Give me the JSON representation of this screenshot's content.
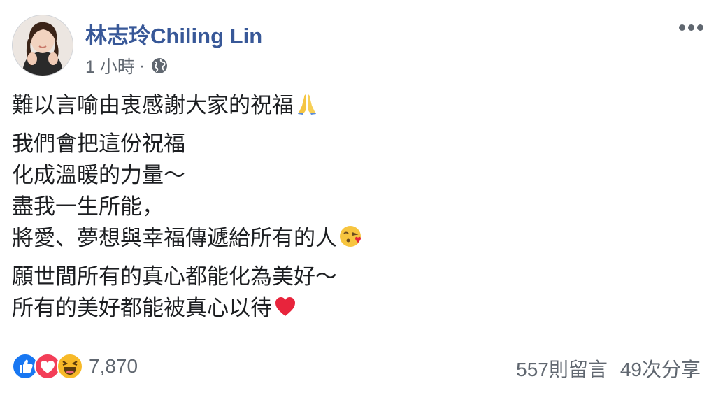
{
  "post": {
    "author": "林志玲Chiling Lin",
    "time": "1 小時",
    "separator": "·",
    "privacy_icon": "globe-icon",
    "more_icon": "ellipsis-icon",
    "paragraphs": [
      [
        "難以言喻由衷感謝大家的祝福"
      ],
      [
        "我們會把這份祝福",
        "化成溫暖的力量～",
        "盡我一生所能，",
        "將愛、夢想與幸福傳遞給所有的人"
      ],
      [
        "願世間所有的真心都能化為美好～",
        "所有的美好都能被真心以待"
      ]
    ],
    "emojis": {
      "p0_l0": "folded-hands-emoji",
      "p1_l3": "face-blowing-kiss-emoji",
      "p2_l1": "red-heart-emoji"
    }
  },
  "reactions": {
    "icons": [
      "like-reaction-icon",
      "love-reaction-icon",
      "haha-reaction-icon"
    ],
    "count": "7,870"
  },
  "stats": {
    "comments": "557則留言",
    "shares": "49次分享"
  },
  "colors": {
    "author": "#385898",
    "meta": "#606770",
    "like": "#1877f2",
    "love": "#f33e58",
    "haha": "#f7b928"
  }
}
